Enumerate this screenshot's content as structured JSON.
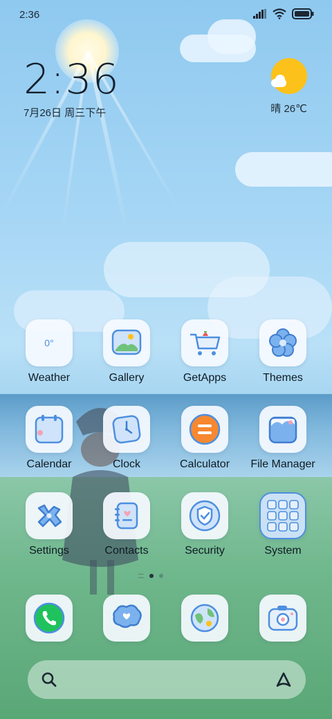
{
  "status_bar": {
    "time": "2:36",
    "icons": [
      "signal-icon",
      "wifi-icon",
      "battery-icon"
    ]
  },
  "clock_widget": {
    "time": "2:36",
    "date": "7月26日 周三下午"
  },
  "weather_widget": {
    "icon": "partly-sunny-icon",
    "text": "晴 26℃"
  },
  "apps": [
    {
      "name": "weather",
      "label": "Weather",
      "icon": "weather-icon",
      "detail": "0°"
    },
    {
      "name": "gallery",
      "label": "Gallery",
      "icon": "gallery-icon"
    },
    {
      "name": "getapps",
      "label": "GetApps",
      "icon": "shopping-cart-icon"
    },
    {
      "name": "themes",
      "label": "Themes",
      "icon": "flower-icon"
    },
    {
      "name": "calendar",
      "label": "Calendar",
      "icon": "calendar-icon"
    },
    {
      "name": "clock",
      "label": "Clock",
      "icon": "clock-icon"
    },
    {
      "name": "calculator",
      "label": "Calculator",
      "icon": "calculator-icon"
    },
    {
      "name": "file-manager",
      "label": "File Manager",
      "icon": "folder-icon"
    },
    {
      "name": "settings",
      "label": "Settings",
      "icon": "wrench-icon"
    },
    {
      "name": "contacts",
      "label": "Contacts",
      "icon": "contacts-book-icon"
    },
    {
      "name": "security",
      "label": "Security",
      "icon": "shield-icon"
    },
    {
      "name": "system",
      "label": "System",
      "icon": "app-folder-icon"
    }
  ],
  "page_indicator": {
    "pages": 3,
    "active": 2
  },
  "dock": [
    {
      "name": "phone",
      "icon": "phone-icon"
    },
    {
      "name": "messaging",
      "icon": "message-bubble-icon"
    },
    {
      "name": "browser",
      "icon": "globe-icon"
    },
    {
      "name": "camera",
      "icon": "camera-icon"
    }
  ],
  "search_bar": {
    "left_icon": "search-icon",
    "right_icon": "assistant-icon"
  },
  "colors": {
    "icon_blue": "#4d8fe0",
    "calculator_orange": "#f7882f",
    "phone_green": "#1fc25c",
    "weather_sun": "#fcc21b"
  }
}
